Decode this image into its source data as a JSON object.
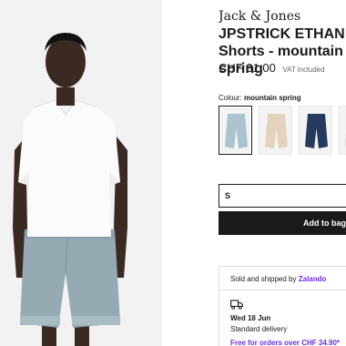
{
  "product": {
    "brand": "Jack & Jones",
    "title": "JPSTRICK ETHAN - Shorts - mountain spring",
    "price": "CHF 31.00",
    "vat": "VAT included"
  },
  "colour": {
    "label": "Colour: ",
    "selected": "mountain spring",
    "swatches": [
      {
        "name": "mountain spring",
        "color": "#a9c3cf"
      },
      {
        "name": "beige",
        "color": "#e3d2bc"
      },
      {
        "name": "navy",
        "color": "#243a5e"
      },
      {
        "name": "white",
        "color": "#f1f1f1"
      }
    ]
  },
  "size": {
    "value": "S"
  },
  "cart": {
    "add_label": "Add to bag"
  },
  "delivery": {
    "sold_prefix": "Sold and shipped by ",
    "seller": "Zalando",
    "date": "Wed 18 Jun",
    "type": "Standard delivery",
    "free_note": "Free for orders over CHF 34.90*"
  }
}
